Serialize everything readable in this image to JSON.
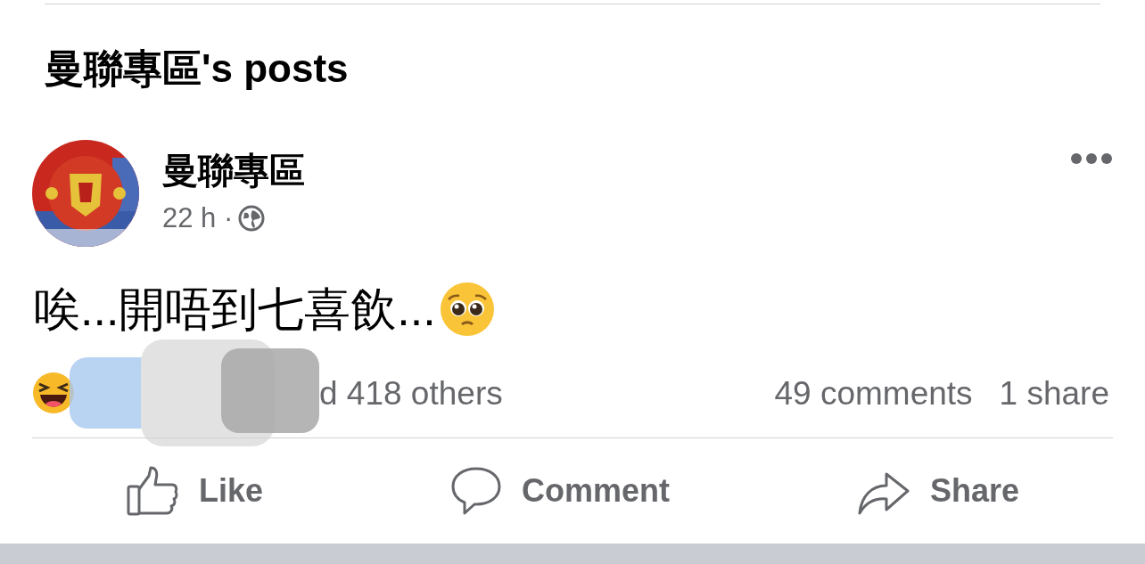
{
  "section_title": "曼聯專區's posts",
  "post": {
    "author": "曼聯專區",
    "time": "22 h ·",
    "text": "唉...開唔到七喜飲...",
    "reactions": {
      "summary": "d 418 others",
      "comments": "49 comments",
      "shares": "1 share"
    },
    "actions": [
      {
        "kind": "like",
        "label": "Like"
      },
      {
        "kind": "comment",
        "label": "Comment"
      },
      {
        "kind": "share",
        "label": "Share"
      }
    ]
  }
}
